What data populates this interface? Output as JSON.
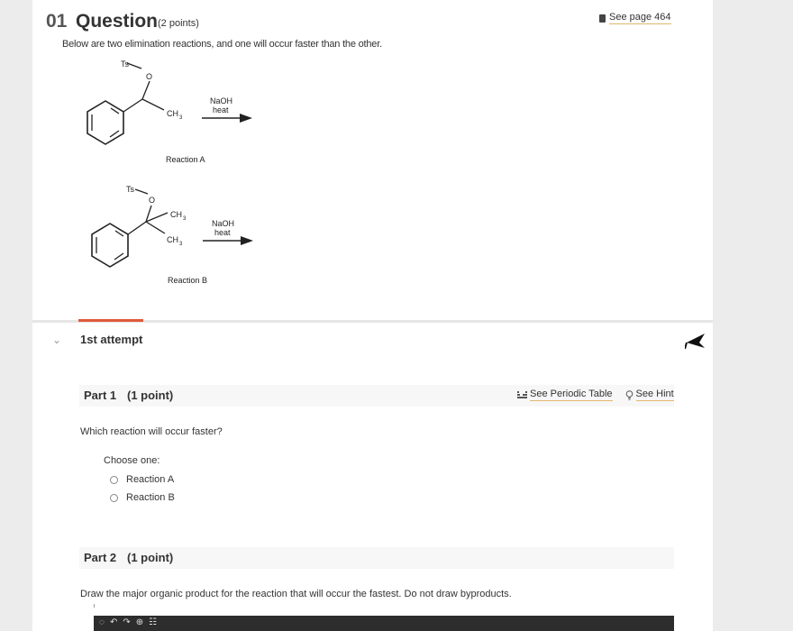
{
  "question": {
    "number": "01",
    "title": "Question",
    "points": "(2 points)",
    "see_page": "See page 464",
    "intro": "Below are two elimination reactions, and one will occur faster than the other."
  },
  "reactions": {
    "a": {
      "ts": "Ts",
      "o": "O",
      "ch3": "CH",
      "sub3": "3",
      "reagent": "NaOH",
      "condition": "heat",
      "label": "Reaction A"
    },
    "b": {
      "ts": "Ts",
      "o": "O",
      "ch3": "CH",
      "sub3": "3",
      "reagent": "NaOH",
      "condition": "heat",
      "label": "Reaction B"
    }
  },
  "attempt": {
    "label": "1st attempt"
  },
  "tools": {
    "periodic_table": "See Periodic Table",
    "hint": "See Hint"
  },
  "part1": {
    "label": "Part 1",
    "points": "(1 point)",
    "prompt": "Which reaction will occur faster?",
    "choose": "Choose one:",
    "options": [
      "Reaction A",
      "Reaction B"
    ]
  },
  "part2": {
    "label": "Part 2",
    "points": "(1 point)",
    "prompt": "Draw the major organic product for the reaction that will occur the fastest. Do not draw byproducts."
  },
  "colors": {
    "accent": "#e05a3a",
    "link_underline": "#e2b86b",
    "editor_bar": "#2d2d2d"
  }
}
